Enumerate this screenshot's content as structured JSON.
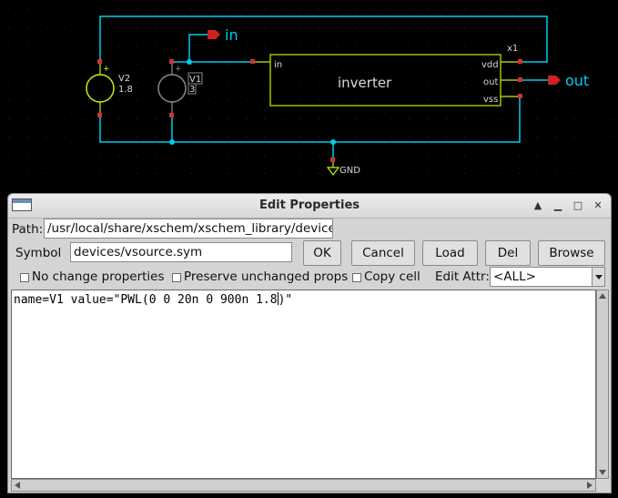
{
  "schematic": {
    "pin_in_label": "in",
    "pin_out_label": "out",
    "block": {
      "name": "inverter",
      "instance": "x1",
      "pin_in": "in",
      "pin_vdd": "vdd",
      "pin_out": "out",
      "pin_vss": "vss"
    },
    "v2": {
      "name": "V2",
      "value": "1.8"
    },
    "v1": {
      "name": "V1",
      "value": "3"
    },
    "gnd_label": "GND",
    "colors": {
      "wire": "#00ccee",
      "component": "#ccee00",
      "pin_marker": "#cc3333",
      "text_light": "#d0d0d0"
    }
  },
  "dialog": {
    "title": "Edit Properties",
    "path_label": "Path:",
    "path_value": "/usr/local/share/xschem/xschem_library/devices",
    "symbol_label": "Symbol",
    "symbol_value": "devices/vsource.sym",
    "buttons": {
      "ok": "OK",
      "cancel": "Cancel",
      "load": "Load",
      "del": "Del",
      "browse": "Browse"
    },
    "checkboxes": {
      "no_change": "No change properties",
      "preserve": "Preserve unchanged props",
      "copy_cell": "Copy cell"
    },
    "edit_attr_label": "Edit Attr:",
    "edit_attr_value": "<ALL>",
    "editor_text_before_cursor": "name=V1 value=\"PWL(0 0 20n 0 900n 1.8",
    "editor_text_after_cursor": ")\""
  }
}
